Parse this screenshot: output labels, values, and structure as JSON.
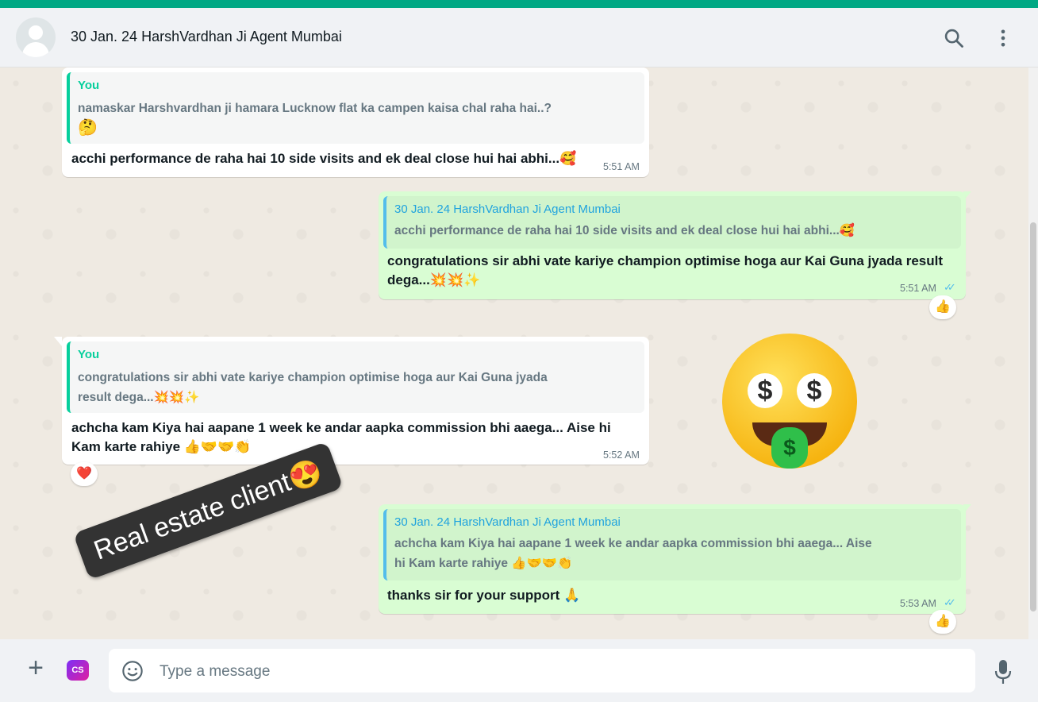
{
  "header": {
    "title": "30 Jan. 24 HarshVardhan Ji Agent Mumbai",
    "search_icon": "search-icon",
    "menu_icon": "kebab-menu-icon"
  },
  "messages": [
    {
      "direction": "incoming",
      "quote_author": "You",
      "quote_text": "namaskar Harshvardhan ji hamara Lucknow flat ka campen kaisa chal raha hai..?",
      "quote_emoji": "🤔",
      "text": "acchi performance de raha hai 10 side visits and ek deal close hui hai abhi...🥰",
      "time": "5:51 AM"
    },
    {
      "direction": "outgoing",
      "quote_author": "30 Jan. 24 HarshVardhan Ji Agent Mumbai",
      "quote_text": "acchi performance de raha hai 10 side visits and ek deal close hui hai abhi...🥰",
      "text_line1": "congratulations sir abhi vate kariye champion optimise hoga aur Kai Guna jyada result",
      "text_line2": "dega...💥💥✨",
      "time": "5:51 AM",
      "status": "read",
      "reaction": "👍"
    },
    {
      "direction": "incoming",
      "quote_author": "You",
      "quote_text_line1": "congratulations sir abhi vate kariye champion optimise hoga aur Kai Guna jyada",
      "quote_text_line2": "result dega...💥💥✨",
      "text_line1": "achcha kam Kiya hai aapane 1 week ke andar aapka commission bhi aaega... Aise hi",
      "text_line2": "Kam karte rahiye 👍🤝🤝👏",
      "time": "5:52 AM",
      "reaction": "❤️"
    },
    {
      "direction": "outgoing",
      "quote_author": "30 Jan. 24 HarshVardhan Ji Agent Mumbai",
      "quote_text_line1": "achcha kam Kiya hai aapane 1 week ke andar aapka commission bhi aaega... Aise",
      "quote_text_line2": "hi Kam karte rahiye 👍🤝🤝👏",
      "text": "thanks sir for your support 🙏",
      "time": "5:53 AM",
      "status": "read",
      "reaction": "👍"
    }
  ],
  "stickers": {
    "money_face": "money-mouth-face-sticker",
    "label": "Real estate client😍"
  },
  "composer": {
    "placeholder": "Type a message",
    "attach_icon": "plus-icon",
    "extension_label": "CS",
    "emoji_icon": "smiley-icon",
    "mic_icon": "mic-icon"
  },
  "colors": {
    "accent": "#00a884",
    "incoming_bubble": "#ffffff",
    "outgoing_bubble": "#d9fdd3",
    "read_ticks": "#53bdeb",
    "chat_background": "#efeae2"
  }
}
